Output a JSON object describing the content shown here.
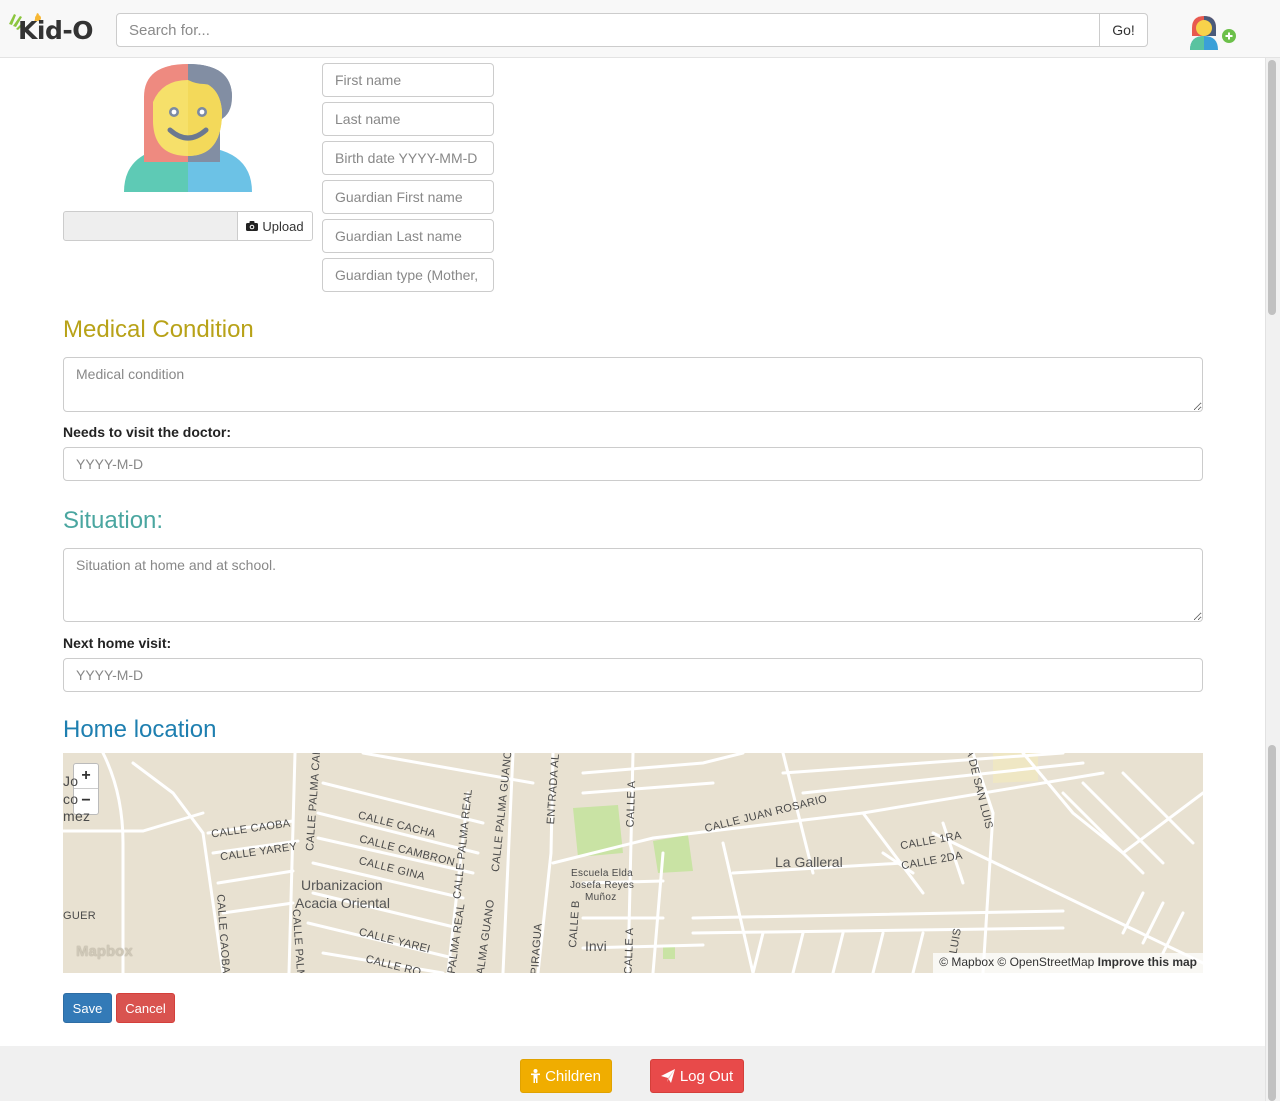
{
  "brand": {
    "name": "Kid-O"
  },
  "header": {
    "search_placeholder": "Search for...",
    "go_label": "Go!"
  },
  "profile": {
    "upload_label": "Upload"
  },
  "form": {
    "first_name_placeholder": "First name",
    "last_name_placeholder": "Last name",
    "birth_date_placeholder": "Birth date YYYY-MM-D",
    "guardian_first_placeholder": "Guardian First name",
    "guardian_last_placeholder": "Guardian Last name",
    "guardian_type_placeholder": "Guardian type (Mother,"
  },
  "medical": {
    "title": "Medical Condition",
    "condition_placeholder": "Medical condition",
    "doctor_label": "Needs to visit the doctor:",
    "doctor_placeholder": "YYYY-M-D"
  },
  "situation": {
    "title": "Situation:",
    "situation_placeholder": "Situation at home and at school.",
    "visit_label": "Next home visit:",
    "visit_placeholder": "YYYY-M-D"
  },
  "location": {
    "title": "Home location",
    "map": {
      "zoom_in": "+",
      "zoom_out": "−",
      "logo": "Mapbox",
      "attribution_text": "© Mapbox © OpenStreetMap",
      "attribution_link": "Improve this map",
      "labels": {
        "calle_caoba": "CALLE CAOBA",
        "calle_yarey": "CALLE YAREY",
        "calle_palma_cana": "CALLE PALMA CANA",
        "calle_cacha": "CALLE CACHA",
        "calle_cambron": "CALLE CAMBRON",
        "calle_gina": "CALLE GINA",
        "calle_palma_real": "CALLE PALMA REAL",
        "calle_palma_guano": "CALLE PALMA GUANO",
        "entrada_al": "ENTRADA AL",
        "calle_a": "CALLE A",
        "calle_juan_rosario": "CALLE JUAN ROSARIO",
        "calle_1ra": "CALLE 1RA",
        "calle_2da": "CALLE 2DA",
        "de_san_luis": "A DE SAN LUIS",
        "la_galleral": "La Galleral",
        "urbanizacion": "Urbanizacion",
        "acacia_oriental": "Acacia Oriental",
        "escuela_1": "Escuela Elda",
        "escuela_2": "Josefa Reyes",
        "escuela_3": "Muñoz",
        "calle_b": "CALLE B",
        "invi": "Invi",
        "calle_yarei": "CALLE YAREI",
        "calle_ro": "CALLE RO",
        "guer": "GUER",
        "piragua": "PIRAGUA",
        "calle_caoba_v": "CALLE CAOBA",
        "calle_palm_v": "CALLE PALM",
        "palma_real_v": "E PALMA REAL",
        "palma_guano_v": "ALMA GUANO",
        "calle_a_v": "CALLE A",
        "luis_v": "LUIS",
        "jo": "Jo",
        "co": "co",
        "mez": "mez"
      }
    }
  },
  "actions": {
    "save_label": "Save",
    "cancel_label": "Cancel"
  },
  "footer": {
    "children_label": "Children",
    "logout_label": "Log Out"
  },
  "colors": {
    "medical_title": "#b8a218",
    "situation_title": "#4aa6a0",
    "home_title": "#1e7fb0",
    "save": "#337ab7",
    "cancel": "#d9534f",
    "children": "#f0ad00",
    "logout": "#e84a4a"
  }
}
